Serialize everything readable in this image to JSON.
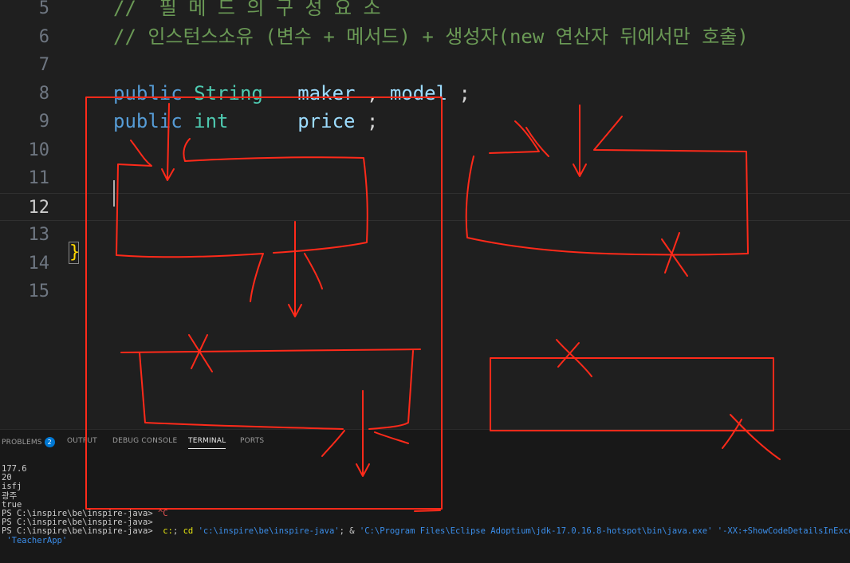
{
  "editor": {
    "lines": [
      {
        "num": "5",
        "tokens": [
          {
            "t": "//  필 메 드 의 구 성 요 소",
            "c": "comment"
          }
        ]
      },
      {
        "num": "6",
        "tokens": [
          {
            "t": "// 인스턴스소유 (변수 + 메서드) + 생성자(new 연산자 뒤에서만 호출)",
            "c": "comment"
          }
        ]
      },
      {
        "num": "7",
        "tokens": []
      },
      {
        "num": "8",
        "tokens": [
          {
            "t": "public",
            "c": "kw"
          },
          {
            "t": " ",
            "c": "punct"
          },
          {
            "t": "String",
            "c": "type"
          },
          {
            "t": "   ",
            "c": "punct"
          },
          {
            "t": "maker",
            "c": "var"
          },
          {
            "t": " , ",
            "c": "punct"
          },
          {
            "t": "model",
            "c": "var"
          },
          {
            "t": " ;",
            "c": "punct"
          }
        ]
      },
      {
        "num": "9",
        "tokens": [
          {
            "t": "public",
            "c": "kw"
          },
          {
            "t": " ",
            "c": "punct"
          },
          {
            "t": "int",
            "c": "type"
          },
          {
            "t": "      ",
            "c": "punct"
          },
          {
            "t": "price",
            "c": "var"
          },
          {
            "t": " ;",
            "c": "punct"
          }
        ]
      },
      {
        "num": "10",
        "tokens": []
      },
      {
        "num": "11",
        "tokens": []
      },
      {
        "num": "12",
        "tokens": []
      },
      {
        "num": "13",
        "tokens": []
      },
      {
        "num": "14",
        "tokens": []
      },
      {
        "num": "15",
        "tokens": []
      }
    ],
    "active_line": "12",
    "closing_brace": "}"
  },
  "panel": {
    "tabs": {
      "problems": "PROBLEMS",
      "problems_count": "2",
      "output": "OUTPUT",
      "debug_console": "DEBUG CONSOLE",
      "terminal": "TERMINAL",
      "ports": "PORTS"
    },
    "terminal_lines": [
      [
        {
          "t": "177.6",
          "c": "arg"
        }
      ],
      [
        {
          "t": "20",
          "c": "arg"
        }
      ],
      [
        {
          "t": "isfj",
          "c": "arg"
        }
      ],
      [
        {
          "t": "광주",
          "c": "arg"
        }
      ],
      [
        {
          "t": "true",
          "c": "arg"
        }
      ],
      [
        {
          "t": "PS C:\\inspire\\be\\inspire-java> ",
          "c": "arg"
        },
        {
          "t": "^C",
          "c": "ctrl"
        }
      ],
      [
        {
          "t": "PS C:\\inspire\\be\\inspire-java>",
          "c": "arg"
        }
      ],
      [
        {
          "t": "PS C:\\inspire\\be\\inspire-java>  ",
          "c": "arg"
        },
        {
          "t": "c:",
          "c": "cmd"
        },
        {
          "t": "; ",
          "c": "arg"
        },
        {
          "t": "cd",
          "c": "cmd"
        },
        {
          "t": " ",
          "c": "arg"
        },
        {
          "t": "'c:\\inspire\\be\\inspire-java'",
          "c": "str"
        },
        {
          "t": "; & ",
          "c": "arg"
        },
        {
          "t": "'C:\\Program Files\\Eclipse Adoptium\\jdk-17.0.16.8-hotspot\\bin\\java.exe'",
          "c": "str"
        },
        {
          "t": " ",
          "c": "arg"
        },
        {
          "t": "'-XX:+ShowCodeDetailsInExceptionMessages'",
          "c": "str"
        }
      ],
      [
        {
          "t": " 'TeacherApp'",
          "c": "str"
        }
      ]
    ]
  },
  "colors": {
    "background": "#1f1f1f",
    "panel": "#181818",
    "annotation": "#ff2a1a",
    "keyword": "#569cd6",
    "type": "#4ec9b0",
    "variable": "#9cdcfe",
    "comment": "#6a9955"
  },
  "icons": {
    "problems_badge": "count-badge"
  }
}
